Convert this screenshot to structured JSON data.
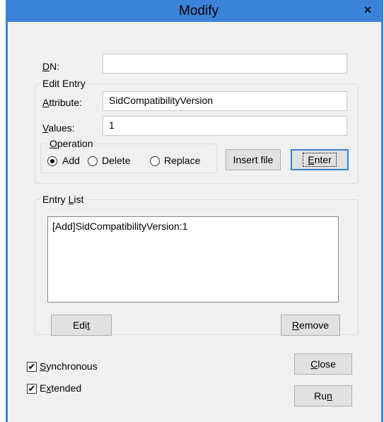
{
  "window": {
    "title": "Modify",
    "close_glyph": "×"
  },
  "dn": {
    "label_u": "D",
    "label_rest": "N:",
    "value": ""
  },
  "edit_entry": {
    "title": "Edit Entry",
    "attribute_label_u": "A",
    "attribute_label_rest": "ttribute:",
    "attribute_value": "SidCompatibilityVersion",
    "values_label_u": "V",
    "values_label_rest": "alues:",
    "values_value": "1",
    "operation": {
      "title_u": "O",
      "title_rest": "peration",
      "options": [
        "Add",
        "Delete",
        "Replace"
      ],
      "selected": "Add"
    },
    "insert_file_label": "Insert file",
    "enter_label_u": "E",
    "enter_label_rest": "nter"
  },
  "entry_list": {
    "title_pre": "Entry ",
    "title_u": "L",
    "title_rest": "ist",
    "items": [
      "[Add]SidCompatibilityVersion:1"
    ],
    "edit_label_pre": "Edi",
    "edit_label_u": "t",
    "remove_label_u": "R",
    "remove_label_rest": "emove"
  },
  "options": {
    "synchronous_u": "S",
    "synchronous_rest": "ynchronous",
    "synchronous_checked": true,
    "extended_pre": "E",
    "extended_u": "x",
    "extended_rest": "tended",
    "extended_checked": true
  },
  "buttons": {
    "close_u": "C",
    "close_rest": "lose",
    "run_pre": "Ru",
    "run_u": "n"
  },
  "icons": {
    "checkbox": "check-icon",
    "radio": "radio-icon"
  },
  "colors": {
    "titlebar": "#3b82d9",
    "dialog_bg": "#f0f0f0",
    "default_button_border": "#3c7fd6"
  }
}
